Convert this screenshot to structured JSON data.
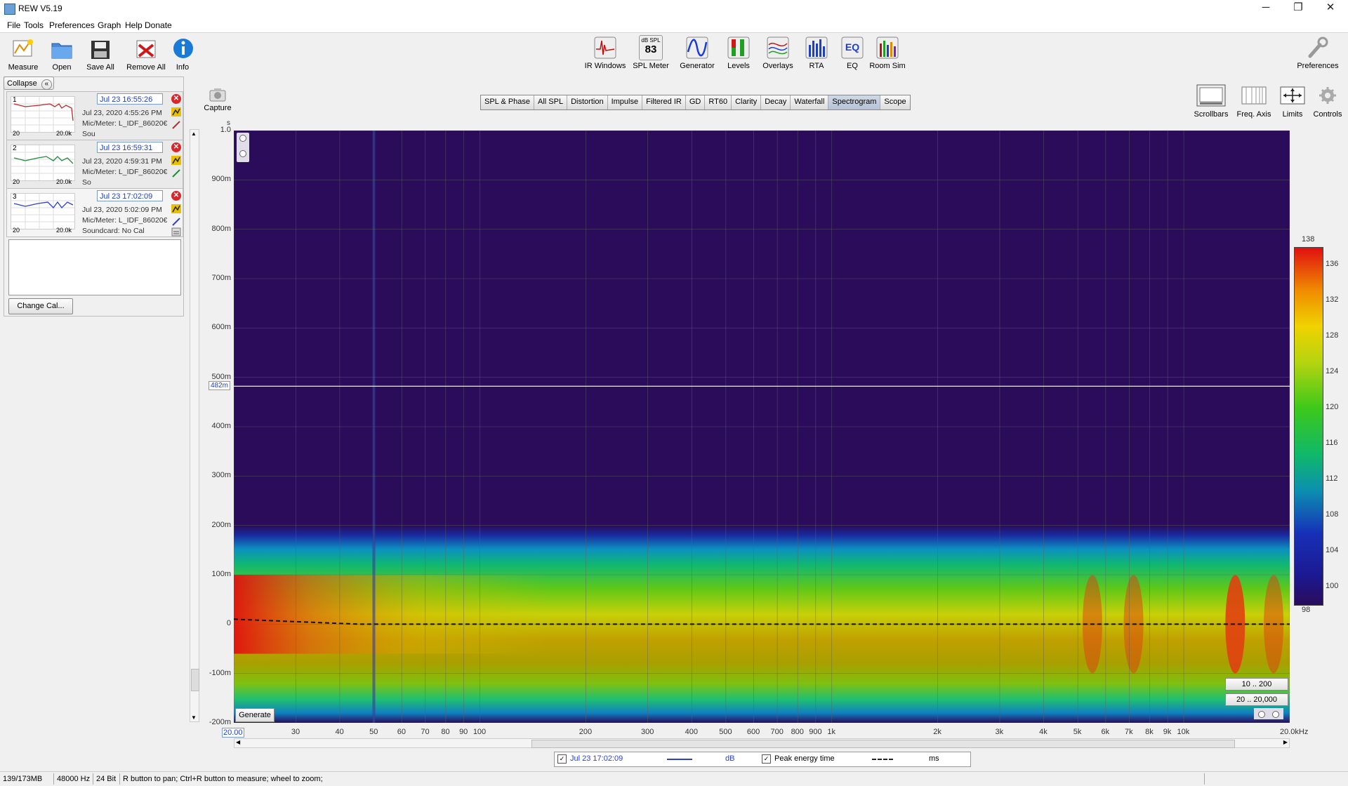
{
  "window": {
    "title": "REW V5.19",
    "minimize": "─",
    "maximize": "❐",
    "close": "✕"
  },
  "menu": [
    "File",
    "Tools",
    "Preferences",
    "Graph",
    "Help",
    "Donate"
  ],
  "toolbar_left": [
    {
      "label": "Measure",
      "icon": "measure-icon"
    },
    {
      "label": "Open",
      "icon": "folder-icon"
    },
    {
      "label": "Save All",
      "icon": "save-icon"
    },
    {
      "label": "Remove All",
      "icon": "remove-icon"
    },
    {
      "label": "Info",
      "icon": "info-icon"
    }
  ],
  "toolbar_center": [
    {
      "label": "IR Windows",
      "icon": "ir-windows-icon"
    },
    {
      "label": "SPL Meter",
      "icon": "spl-meter-icon",
      "badge_top": "dB SPL",
      "badge_value": "83"
    },
    {
      "label": "Generator",
      "icon": "generator-icon"
    },
    {
      "label": "Levels",
      "icon": "levels-icon"
    },
    {
      "label": "Overlays",
      "icon": "overlays-icon"
    },
    {
      "label": "RTA",
      "icon": "rta-icon"
    },
    {
      "label": "EQ",
      "icon": "eq-icon"
    },
    {
      "label": "Room Sim",
      "icon": "room-sim-icon"
    }
  ],
  "toolbar_right": {
    "label": "Preferences",
    "icon": "wrench-icon"
  },
  "capture": {
    "label": "Capture"
  },
  "graph_tabs": [
    "SPL & Phase",
    "All SPL",
    "Distortion",
    "Impulse",
    "Filtered IR",
    "GD",
    "RT60",
    "Clarity",
    "Decay",
    "Waterfall",
    "Spectrogram",
    "Scope"
  ],
  "active_tab": "Spectrogram",
  "graph_tools": [
    {
      "label": "Scrollbars",
      "icon": "scrollbars-icon"
    },
    {
      "label": "Freq. Axis",
      "icon": "freq-axis-icon"
    },
    {
      "label": "Limits",
      "icon": "limits-icon"
    },
    {
      "label": "Controls",
      "icon": "gear-icon"
    }
  ],
  "sidebar": {
    "collapse_label": "Collapse",
    "collapse_icon": "«",
    "change_cal_label": "Change Cal...",
    "measurements": [
      {
        "number": "1",
        "name": "Jul 23 16:55:26",
        "date_line": "Jul 23, 2020 4:55:26 PM",
        "mic_line": "Mic/Meter: L_IDF_86020€",
        "sound_line": "Sou",
        "trace_color": "#c0282b",
        "thumb_left": "20",
        "thumb_right": "20.0k"
      },
      {
        "number": "2",
        "name": "Jul 23 16:59:31",
        "date_line": "Jul 23, 2020 4:59:31 PM",
        "mic_line": "Mic/Meter: L_IDF_86020€",
        "sound_line": "So",
        "trace_color": "#1e8a3a",
        "thumb_left": "20",
        "thumb_right": "20.0k"
      },
      {
        "number": "3",
        "name": "Jul 23 17:02:09",
        "date_line": "Jul 23, 2020 5:02:09 PM",
        "mic_line": "Mic/Meter: L_IDF_86020€",
        "sound_line": "Soundcard: No Cal",
        "trace_color": "#2c3fd0",
        "thumb_left": "20",
        "thumb_right": "20.0k"
      }
    ]
  },
  "chart_data": {
    "type": "heatmap",
    "subtype": "spectrogram",
    "x_axis": {
      "scale": "log",
      "unit": "Hz",
      "range": [
        20,
        20000
      ],
      "ticks": [
        "20.00",
        "30",
        "40",
        "50",
        "60",
        "70",
        "80",
        "90",
        "100",
        "200",
        "300",
        "400",
        "500",
        "600",
        "700",
        "800",
        "900",
        "1k",
        "2k",
        "3k",
        "4k",
        "5k",
        "6k",
        "7k",
        "8k",
        "9k",
        "10k",
        "20.0kHz"
      ]
    },
    "y_axis": {
      "unit": "s",
      "range": [
        -0.2,
        1.0
      ],
      "ticks": [
        "1.0",
        "900m",
        "800m",
        "700m",
        "600m",
        "500m",
        "400m",
        "300m",
        "200m",
        "100m",
        "0",
        "-100m",
        "-200m"
      ],
      "cursor_label": "482m",
      "cursor_value": 0.482
    },
    "color_scale": {
      "min": 98,
      "max": 138,
      "ticks": [
        "138",
        "136",
        "132",
        "128",
        "124",
        "120",
        "116",
        "112",
        "108",
        "104",
        "100",
        "98"
      ]
    },
    "peak_energy_line": {
      "y_at_20Hz": 0.01,
      "y_elsewhere": 0.0
    },
    "grid": true
  },
  "plot_controls": {
    "generate_label": "Generate",
    "range_1": "10 .. 200",
    "range_2": "20 .. 20,000"
  },
  "legend": {
    "measurement": "Jul 23 17:02:09",
    "unit1": "dB",
    "peak_label": "Peak energy time",
    "unit2": "ms",
    "measurement_color": "#2c3fd0"
  },
  "status": {
    "memory": "139/173MB",
    "rate": "48000 Hz",
    "bits": "24 Bit",
    "hint": "R button to pan; Ctrl+R button to measure; wheel to zoom;"
  }
}
